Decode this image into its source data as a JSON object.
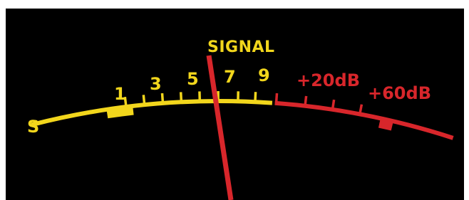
{
  "meter": {
    "title": "SIGNAL",
    "s_label": "S",
    "s_scale": [
      "1",
      "3",
      "5",
      "7",
      "9"
    ],
    "db_scale": [
      "+20dB",
      "+60dB"
    ],
    "colors": {
      "background": "#000000",
      "scale": "#f2d61c",
      "over_scale": "#d8262b",
      "needle": "#d8262b"
    }
  }
}
